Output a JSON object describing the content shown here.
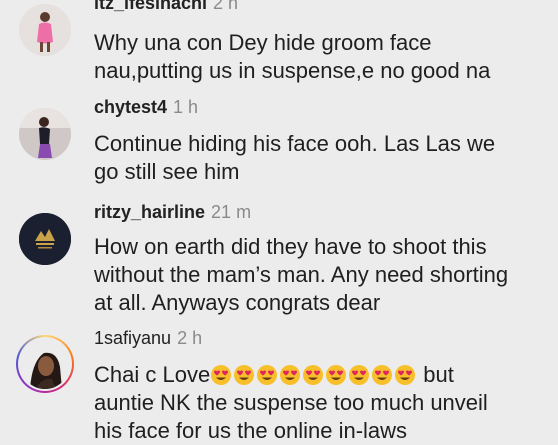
{
  "comments": [
    {
      "username": "itz_ifesinachi",
      "time": "2 h",
      "avatar_icon": "pink-dress-avatar-icon",
      "text_lines": [
        "Why una con Dey hide groom face",
        "nau,putting us in suspense,e no good na"
      ]
    },
    {
      "username": "chytest4",
      "time": "1 h",
      "avatar_icon": "woman-photo-avatar-icon",
      "text_lines": [
        "Continue hiding his face ooh. Las Las we",
        "go still see him"
      ]
    },
    {
      "username": "ritzy_hairline",
      "time": "21 m",
      "avatar_icon": "gold-logo-avatar-icon",
      "text_lines": [
        "How on earth did they have to shoot this",
        "without the mam’s man. Any need shorting",
        "at all. Anyways congrats dear"
      ]
    },
    {
      "username": "1safiyanu",
      "time": "2 h",
      "avatar_icon": "portrait-avatar-icon",
      "text_start": "Chai c Love",
      "emoji_name": "smiling-face-with-heart-eyes-emoji",
      "emoji_count": 9,
      "text_end": " but",
      "text_lines": [
        "auntie NK the suspense too much unveil",
        "his face for us the online in-laws"
      ]
    }
  ],
  "colors": {
    "background": "#ececec",
    "username": "#222222",
    "timestamp": "#8a8a8a",
    "story_ring": "#c13584",
    "emoji_face": "#f7c02b",
    "emoji_heart": "#e0245e"
  }
}
